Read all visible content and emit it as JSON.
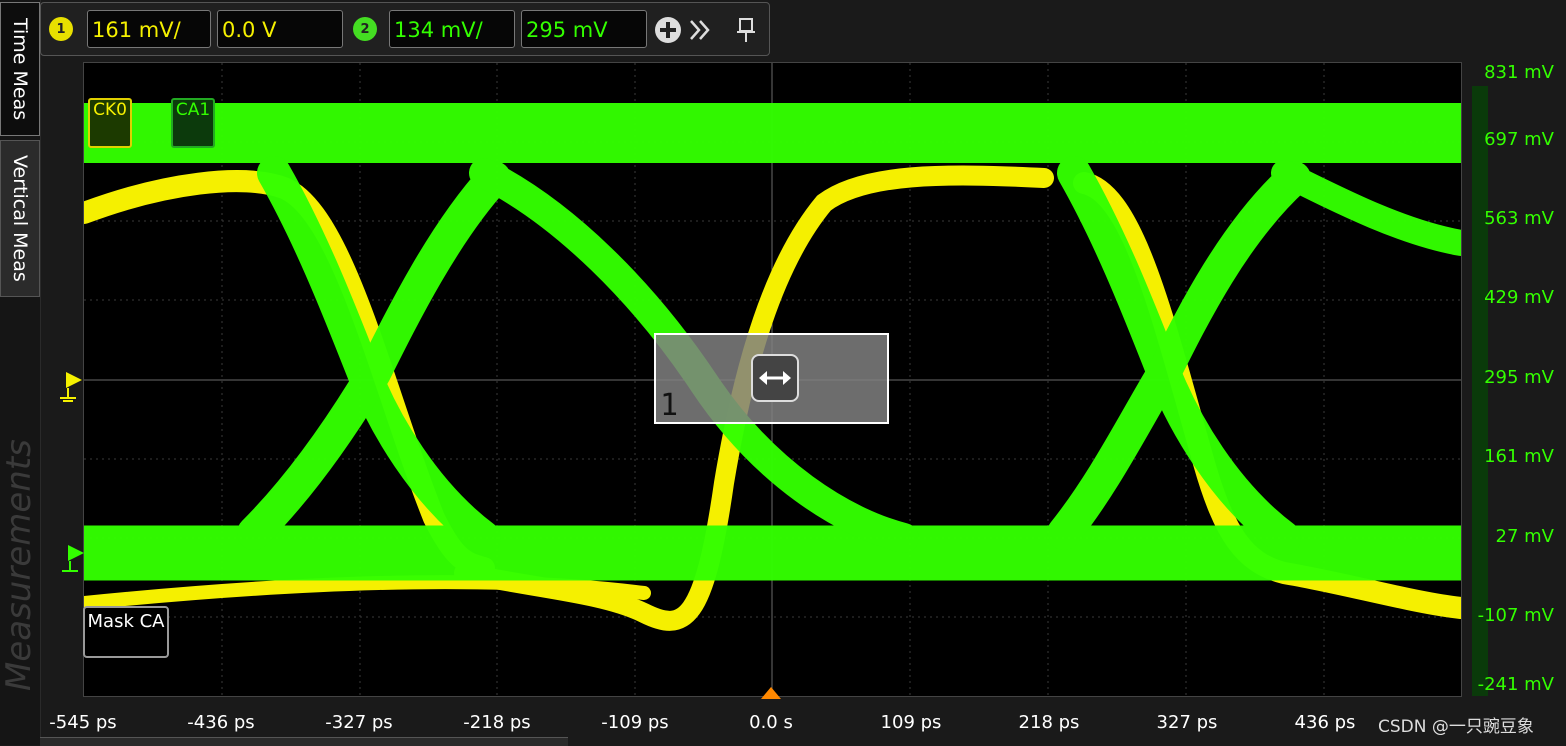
{
  "side_tabs": {
    "time_meas": "Time Meas",
    "vertical_meas": "Vertical Meas",
    "measurements": "Measurements"
  },
  "toolbar": {
    "ch1": {
      "badge": "1",
      "scale": "161 mV/",
      "offset": "0.0 V",
      "color": "#f5f000"
    },
    "ch2": {
      "badge": "2",
      "scale": "134 mV/",
      "offset": "295 mV",
      "color": "#33ff00"
    },
    "add_icon": "plus-circle-icon",
    "expand_icon": "double-chevron-right-icon",
    "pin_icon": "pin-icon"
  },
  "waveform_tags": {
    "ck0": "CK0",
    "ca1": "CA1"
  },
  "y_axis_labels": [
    "831 mV",
    "697 mV",
    "563 mV",
    "429 mV",
    "295 mV",
    "161 mV",
    "27 mV",
    "-107 mV",
    "-241 mV"
  ],
  "x_axis_labels": [
    "-545 ps",
    "-436 ps",
    "-327 ps",
    "-218 ps",
    "-109 ps",
    "0.0 s",
    "109 ps",
    "218 ps",
    "327 ps",
    "436 ps"
  ],
  "mask": {
    "button_label": "Mask CA",
    "region_number": "1"
  },
  "watermark": "CSDN @一只豌豆象",
  "colors": {
    "ch1": "#f5f000",
    "ch2": "#33ff00",
    "background": "#000000"
  }
}
